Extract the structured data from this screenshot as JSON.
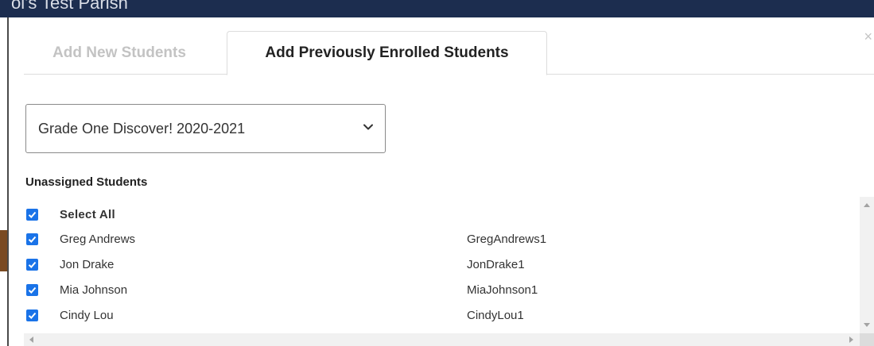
{
  "background": {
    "header_text": "ol's Test Parish"
  },
  "modal": {
    "close_glyph": "×",
    "tabs": [
      {
        "label": "Add New Students",
        "active": false
      },
      {
        "label": "Add Previously Enrolled Students",
        "active": true
      }
    ],
    "class_select": {
      "selected": "Grade One Discover! 2020-2021"
    },
    "section_label": "Unassigned Students",
    "select_all": {
      "label": "Select All",
      "checked": true
    },
    "students": [
      {
        "name": "Greg Andrews",
        "username": "GregAndrews1",
        "checked": true
      },
      {
        "name": "Jon Drake",
        "username": "JonDrake1",
        "checked": true
      },
      {
        "name": "Mia Johnson",
        "username": "MiaJohnson1",
        "checked": true
      },
      {
        "name": "Cindy Lou",
        "username": "CindyLou1",
        "checked": true
      }
    ]
  },
  "colors": {
    "checkbox": "#1a73e8",
    "header_bar": "#1c2d4f",
    "inactive_tab": "#c3c3c3"
  }
}
